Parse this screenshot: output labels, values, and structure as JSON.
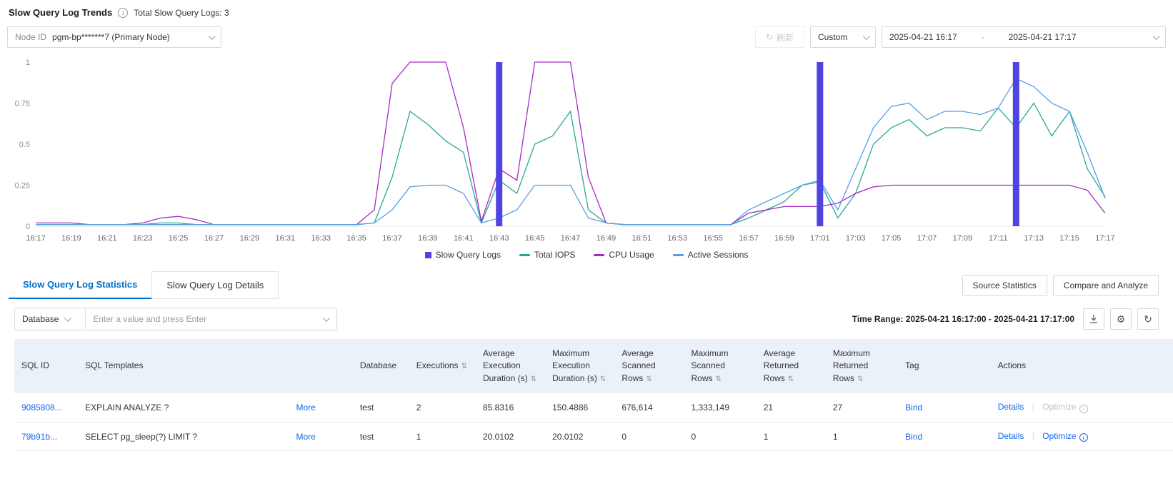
{
  "colors": {
    "link": "#1366ec",
    "tab_active": "#0070cc",
    "table_header_bg": "#eaf1f9",
    "disabled": "#bfbfbf"
  },
  "header": {
    "title": "Slow Query Log Trends",
    "total_label": "Total Slow Query Logs: 3"
  },
  "toolbar": {
    "node_label": "Node ID",
    "node_value": "pgm-bp*******7 (Primary Node)",
    "refresh_label": "刷新",
    "range_type": "Custom",
    "range_start": "2025-04-21 16:17",
    "range_sep": "-",
    "range_end": "2025-04-21 17:17"
  },
  "chart_data": {
    "type": "line",
    "title": "Slow Query Log Trends",
    "ylim": [
      0,
      1
    ],
    "yticks": [
      0,
      0.25,
      0.5,
      0.75,
      1
    ],
    "grid": false,
    "legend_position": "bottom",
    "points": 61,
    "x_labels": [
      "16:17",
      "16:19",
      "16:21",
      "16:23",
      "16:25",
      "16:27",
      "16:29",
      "16:31",
      "16:33",
      "16:35",
      "16:37",
      "16:39",
      "16:41",
      "16:43",
      "16:45",
      "16:47",
      "16:49",
      "16:51",
      "16:53",
      "16:55",
      "16:57",
      "16:59",
      "17:01",
      "17:03",
      "17:05",
      "17:07",
      "17:09",
      "17:11",
      "17:13",
      "17:15",
      "17:17"
    ],
    "bars": {
      "name": "Slow Query Logs",
      "color": "#4f44e0",
      "indices": [
        26,
        44,
        55
      ],
      "value": 1
    },
    "series": [
      {
        "name": "Total IOPS",
        "color": "#27a899",
        "values": [
          0.01,
          0.01,
          0.01,
          0.01,
          0.01,
          0.01,
          0.01,
          0.02,
          0.02,
          0.01,
          0.01,
          0.01,
          0.01,
          0.01,
          0.01,
          0.01,
          0.01,
          0.01,
          0.01,
          0.02,
          0.3,
          0.7,
          0.62,
          0.52,
          0.45,
          0.02,
          0.28,
          0.2,
          0.5,
          0.55,
          0.7,
          0.1,
          0.02,
          0.01,
          0.01,
          0.01,
          0.01,
          0.01,
          0.01,
          0.01,
          0.05,
          0.1,
          0.15,
          0.25,
          0.27,
          0.05,
          0.2,
          0.5,
          0.6,
          0.65,
          0.55,
          0.6,
          0.6,
          0.58,
          0.72,
          0.6,
          0.75,
          0.55,
          0.7,
          0.35,
          0.18
        ]
      },
      {
        "name": "CPU Usage",
        "color": "#a62ac4",
        "values": [
          0.02,
          0.02,
          0.02,
          0.01,
          0.01,
          0.01,
          0.02,
          0.05,
          0.06,
          0.04,
          0.01,
          0.01,
          0.01,
          0.01,
          0.01,
          0.01,
          0.01,
          0.01,
          0.01,
          0.1,
          0.87,
          1,
          1,
          1,
          0.6,
          0.03,
          0.35,
          0.28,
          1,
          1,
          1,
          0.3,
          0.02,
          0.01,
          0.01,
          0.01,
          0.01,
          0.01,
          0.01,
          0.01,
          0.08,
          0.1,
          0.12,
          0.12,
          0.12,
          0.14,
          0.2,
          0.24,
          0.25,
          0.25,
          0.25,
          0.25,
          0.25,
          0.25,
          0.25,
          0.25,
          0.25,
          0.25,
          0.25,
          0.22,
          0.08
        ]
      },
      {
        "name": "Active Sessions",
        "color": "#549fe8",
        "values": [
          0.01,
          0.01,
          0.01,
          0.01,
          0.01,
          0.01,
          0.01,
          0.01,
          0.01,
          0.01,
          0.01,
          0.01,
          0.01,
          0.01,
          0.01,
          0.01,
          0.01,
          0.01,
          0.01,
          0.02,
          0.1,
          0.24,
          0.25,
          0.25,
          0.2,
          0.02,
          0.05,
          0.1,
          0.25,
          0.25,
          0.25,
          0.05,
          0.02,
          0.01,
          0.01,
          0.01,
          0.01,
          0.01,
          0.01,
          0.01,
          0.1,
          0.15,
          0.2,
          0.25,
          0.28,
          0.1,
          0.35,
          0.6,
          0.73,
          0.75,
          0.65,
          0.7,
          0.7,
          0.68,
          0.72,
          0.9,
          0.85,
          0.75,
          0.7,
          0.45,
          0.17
        ]
      }
    ],
    "legend": [
      {
        "label": "Slow Query Logs",
        "color": "#4f44e0",
        "marker": "square"
      },
      {
        "label": "Total IOPS",
        "color": "#27a899",
        "marker": "line"
      },
      {
        "label": "CPU Usage",
        "color": "#a62ac4",
        "marker": "line"
      },
      {
        "label": "Active Sessions",
        "color": "#549fe8",
        "marker": "line"
      }
    ]
  },
  "tabs": [
    {
      "label": "Slow Query Log Statistics",
      "active": true
    },
    {
      "label": "Slow Query Log Details",
      "active": false
    }
  ],
  "panel_actions": {
    "source_statistics": "Source Statistics",
    "compare_analyze": "Compare and Analyze"
  },
  "filter": {
    "field": "Database",
    "placeholder": "Enter a value and press Enter",
    "time_range": "Time Range: 2025-04-21 16:17:00 - 2025-04-21 17:17:00"
  },
  "table": {
    "columns": [
      {
        "label": "SQL ID",
        "sortable": false
      },
      {
        "label": "SQL Templates",
        "sortable": false
      },
      {
        "label": "Database",
        "sortable": false
      },
      {
        "label": "Executions",
        "sortable": true
      },
      {
        "label": "Average Execution Duration (s)",
        "sortable": true
      },
      {
        "label": "Maximum Execution Duration (s)",
        "sortable": true
      },
      {
        "label": "Average Scanned Rows",
        "sortable": true
      },
      {
        "label": "Maximum Scanned Rows",
        "sortable": true
      },
      {
        "label": "Average Returned Rows",
        "sortable": true
      },
      {
        "label": "Maximum Returned Rows",
        "sortable": true
      },
      {
        "label": "Tag",
        "sortable": false
      },
      {
        "label": "Actions",
        "sortable": false
      }
    ],
    "links": {
      "more": "More",
      "details": "Details",
      "optimize": "Optimize"
    },
    "rows": [
      {
        "sql_id": "9085808...",
        "template": "EXPLAIN ANALYZE ?",
        "database": "test",
        "executions": "2",
        "avg_exec_duration": "85.8316",
        "max_exec_duration": "150.4886",
        "avg_scanned_rows": "676,614",
        "max_scanned_rows": "1,333,149",
        "avg_returned_rows": "21",
        "max_returned_rows": "27",
        "tag": "Bind",
        "optimize_disabled": true
      },
      {
        "sql_id": "79b91b...",
        "template": "SELECT pg_sleep(?) LIMIT ?",
        "database": "test",
        "executions": "1",
        "avg_exec_duration": "20.0102",
        "max_exec_duration": "20.0102",
        "avg_scanned_rows": "0",
        "max_scanned_rows": "0",
        "avg_returned_rows": "1",
        "max_returned_rows": "1",
        "tag": "Bind",
        "optimize_disabled": false
      }
    ]
  }
}
